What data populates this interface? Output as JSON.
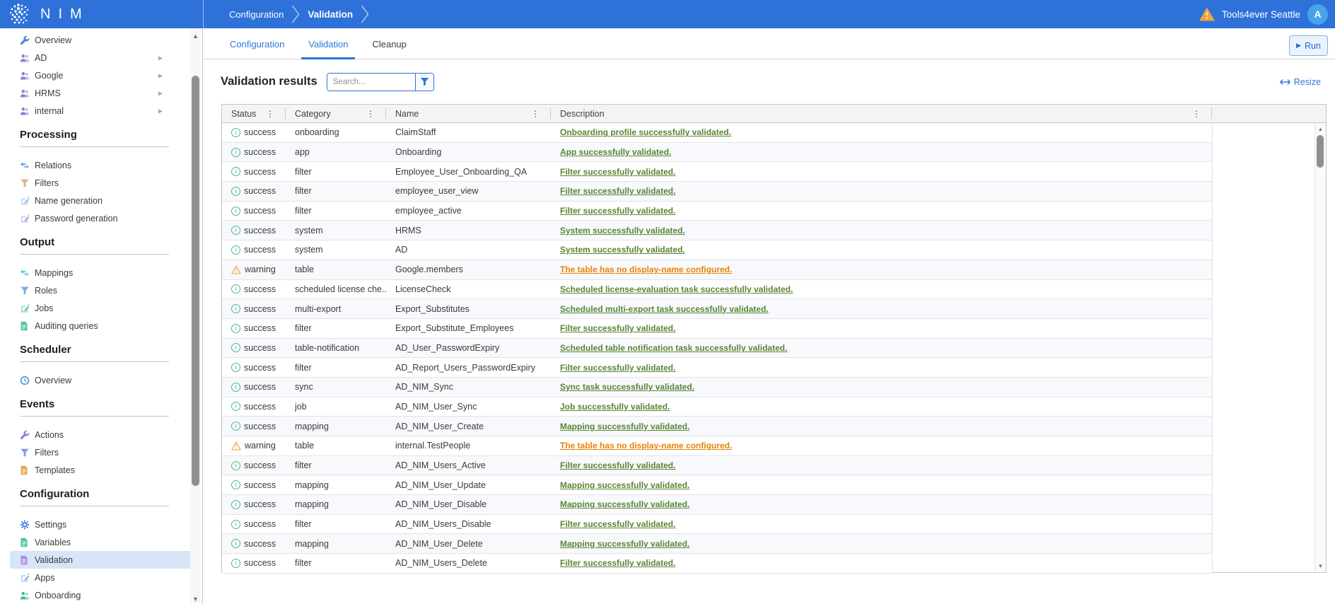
{
  "header": {
    "app_name": "NIM",
    "breadcrumbs": [
      {
        "label": "Configuration",
        "bold": false
      },
      {
        "label": "Validation",
        "bold": true
      }
    ],
    "org_name": "Tools4ever Seattle",
    "avatar_initial": "A",
    "colors": {
      "header_bg": "#2e71d9",
      "avatar_bg": "#46a3ec",
      "warning": "#f2a33c"
    }
  },
  "sidebar": {
    "sections": [
      {
        "header": null,
        "items": [
          {
            "label": "Overview",
            "icon": "wrench",
            "color": "#4b89d8",
            "expandable": false
          },
          {
            "label": "AD",
            "icon": "people",
            "color": "#8f7ed8",
            "expandable": true
          },
          {
            "label": "Google",
            "icon": "people",
            "color": "#8f7ed8",
            "expandable": true
          },
          {
            "label": "HRMS",
            "icon": "people",
            "color": "#8f7ed8",
            "expandable": true
          },
          {
            "label": "internal",
            "icon": "people",
            "color": "#8f7ed8",
            "expandable": true
          }
        ]
      },
      {
        "header": "Processing",
        "items": [
          {
            "label": "Relations",
            "icon": "arrows",
            "color": "#4a9be0"
          },
          {
            "label": "Filters",
            "icon": "funnel",
            "color": "#ddb184"
          },
          {
            "label": "Name generation",
            "icon": "pencil",
            "color": "#7fb0e8"
          },
          {
            "label": "Password generation",
            "icon": "pencil",
            "color": "#a98fd9"
          }
        ]
      },
      {
        "header": "Output",
        "items": [
          {
            "label": "Mappings",
            "icon": "arrows",
            "color": "#35c3dc"
          },
          {
            "label": "Roles",
            "icon": "funnel",
            "color": "#7fa9e8"
          },
          {
            "label": "Jobs",
            "icon": "pencil",
            "color": "#43b98c"
          },
          {
            "label": "Auditing queries",
            "icon": "document",
            "color": "#4cc3a5"
          }
        ]
      },
      {
        "header": "Scheduler",
        "items": [
          {
            "label": "Overview",
            "icon": "clock",
            "color": "#5b9bd5"
          }
        ]
      },
      {
        "header": "Events",
        "items": [
          {
            "label": "Actions",
            "icon": "wrench",
            "color": "#9a7fd8"
          },
          {
            "label": "Filters",
            "icon": "funnel",
            "color": "#8898e0"
          },
          {
            "label": "Templates",
            "icon": "document",
            "color": "#e8a54b"
          }
        ]
      },
      {
        "header": "Configuration",
        "items": [
          {
            "label": "Settings",
            "icon": "gear",
            "color": "#3b7dd8"
          },
          {
            "label": "Variables",
            "icon": "document",
            "color": "#4cc3a5"
          },
          {
            "label": "Validation",
            "icon": "document",
            "color": "#a98fd9",
            "selected": true
          },
          {
            "label": "Apps",
            "icon": "pencil",
            "color": "#6fa5e0"
          },
          {
            "label": "Onboarding",
            "icon": "people",
            "color": "#3dbd9a"
          }
        ]
      }
    ]
  },
  "main": {
    "tabs": [
      {
        "label": "Configuration",
        "active": false,
        "highlighted": true
      },
      {
        "label": "Validation",
        "active": true,
        "highlighted": true
      },
      {
        "label": "Cleanup",
        "active": false,
        "highlighted": false
      }
    ],
    "run_label": "Run",
    "title": "Validation results",
    "search_placeholder": "Search...",
    "resize_label": "Resize",
    "table": {
      "columns": [
        "Status",
        "Category",
        "Name",
        "Description"
      ],
      "status_colors": {
        "success": "#4fb391",
        "warning": "#eda94f"
      },
      "description_colors": {
        "success": "#5a8434",
        "warning": "#e8820a"
      },
      "rows": [
        {
          "status": "success",
          "category": "onboarding",
          "name": "ClaimStaff",
          "description": "Onboarding profile successfully validated."
        },
        {
          "status": "success",
          "category": "app",
          "name": "Onboarding",
          "description": "App successfully validated."
        },
        {
          "status": "success",
          "category": "filter",
          "name": "Employee_User_Onboarding_QA",
          "description": "Filter successfully validated."
        },
        {
          "status": "success",
          "category": "filter",
          "name": "employee_user_view",
          "description": "Filter successfully validated."
        },
        {
          "status": "success",
          "category": "filter",
          "name": "employee_active",
          "description": "Filter successfully validated."
        },
        {
          "status": "success",
          "category": "system",
          "name": "HRMS",
          "description": "System successfully validated."
        },
        {
          "status": "success",
          "category": "system",
          "name": "AD",
          "description": "System successfully validated."
        },
        {
          "status": "warning",
          "category": "table",
          "name": "Google.members",
          "description": "The table has no display-name configured."
        },
        {
          "status": "success",
          "category": "scheduled license che...",
          "name": "LicenseCheck",
          "description": "Scheduled license-evaluation task successfully validated."
        },
        {
          "status": "success",
          "category": "multi-export",
          "name": "Export_Substitutes",
          "description": "Scheduled multi-export task successfully validated."
        },
        {
          "status": "success",
          "category": "filter",
          "name": "Export_Substitute_Employees",
          "description": "Filter successfully validated."
        },
        {
          "status": "success",
          "category": "table-notification",
          "name": "AD_User_PasswordExpiry",
          "description": "Scheduled table notification task successfully validated."
        },
        {
          "status": "success",
          "category": "filter",
          "name": "AD_Report_Users_PasswordExpiry",
          "description": "Filter successfully validated."
        },
        {
          "status": "success",
          "category": "sync",
          "name": "AD_NIM_Sync",
          "description": "Sync task successfully validated."
        },
        {
          "status": "success",
          "category": "job",
          "name": "AD_NIM_User_Sync",
          "description": "Job successfully validated."
        },
        {
          "status": "success",
          "category": "mapping",
          "name": "AD_NIM_User_Create",
          "description": "Mapping successfully validated."
        },
        {
          "status": "warning",
          "category": "table",
          "name": "internal.TestPeople",
          "description": "The table has no display-name configured."
        },
        {
          "status": "success",
          "category": "filter",
          "name": "AD_NIM_Users_Active",
          "description": "Filter successfully validated."
        },
        {
          "status": "success",
          "category": "mapping",
          "name": "AD_NIM_User_Update",
          "description": "Mapping successfully validated."
        },
        {
          "status": "success",
          "category": "mapping",
          "name": "AD_NIM_User_Disable",
          "description": "Mapping successfully validated."
        },
        {
          "status": "success",
          "category": "filter",
          "name": "AD_NIM_Users_Disable",
          "description": "Filter successfully validated."
        },
        {
          "status": "success",
          "category": "mapping",
          "name": "AD_NIM_User_Delete",
          "description": "Mapping successfully validated."
        },
        {
          "status": "success",
          "category": "filter",
          "name": "AD_NIM_Users_Delete",
          "description": "Filter successfully validated."
        }
      ]
    }
  }
}
